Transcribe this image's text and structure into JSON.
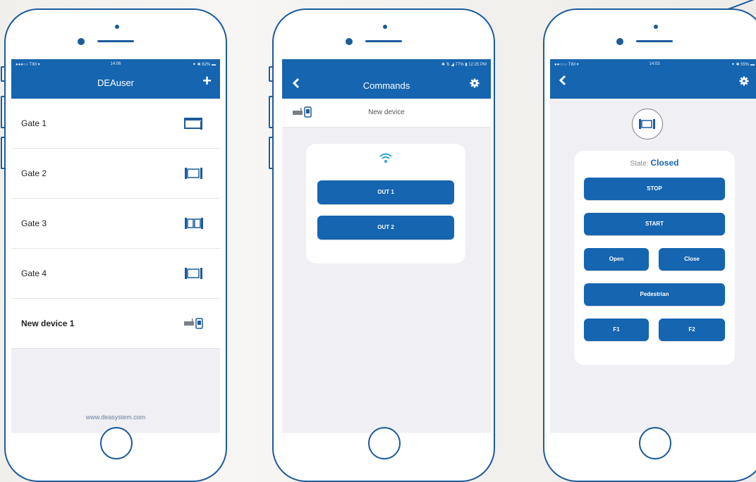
{
  "colors": {
    "primary": "#1565b0",
    "phone_outline": "#1d5b9c",
    "screen_bg": "#efeff4"
  },
  "phone1": {
    "status": {
      "left": "●●●○○ TIM ▾",
      "time": "14:06",
      "right": "✦ ✱ 62% ▬"
    },
    "title": "DEAuser",
    "add_icon": "plus-icon",
    "devices": [
      {
        "name": "Gate 1",
        "icon": "sliding-gate-icon"
      },
      {
        "name": "Gate 2",
        "icon": "single-gate-icon"
      },
      {
        "name": "Gate 3",
        "icon": "double-gate-icon"
      },
      {
        "name": "Gate 4",
        "icon": "single-gate-icon"
      },
      {
        "name": "New device 1",
        "icon": "receiver-icon"
      }
    ],
    "footer": "www.deasystem.com"
  },
  "phone2": {
    "status": {
      "right": "✱ ⇅ ◢ 77% ▮ 12:25 PM"
    },
    "title": "Commands",
    "back_icon": "back-chevron-icon",
    "settings_icon": "gear-icon",
    "device_name": "New device",
    "wifi_icon": "wifi-icon",
    "buttons": [
      "OUT 1",
      "OUT 2"
    ]
  },
  "phone3": {
    "status": {
      "left": "●●○○○ TIM ▾",
      "time": "14:03",
      "right": "✦ ✱ 55% ▬"
    },
    "back_icon": "back-chevron-icon",
    "settings_icon": "gear-icon",
    "state_label": "State:",
    "state_value": "Closed",
    "buttons": {
      "stop": "STOP",
      "start": "START",
      "open": "Open",
      "close": "Close",
      "pedestrian": "Pedestrian",
      "f1": "F1",
      "f2": "F2"
    }
  }
}
